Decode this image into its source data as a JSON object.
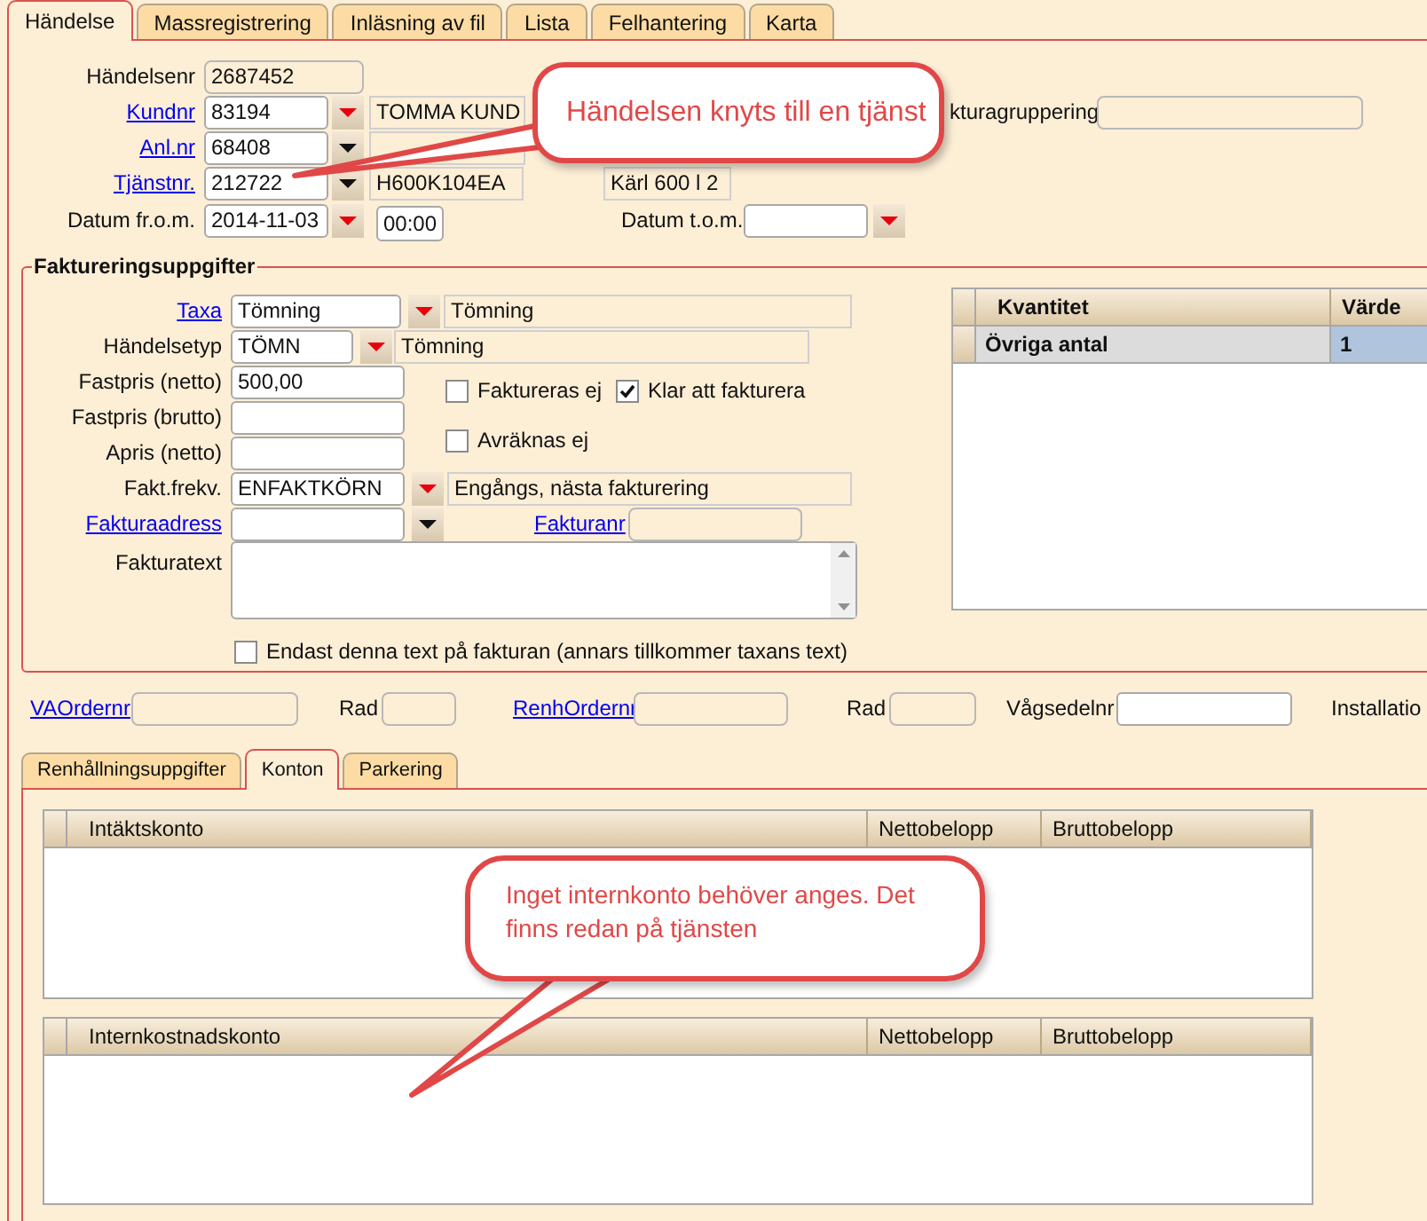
{
  "tabs": [
    {
      "label": "Händelse",
      "selected": true
    },
    {
      "label": "Massregistrering",
      "selected": false
    },
    {
      "label": "Inläsning av fil",
      "selected": false
    },
    {
      "label": "Lista",
      "selected": false
    },
    {
      "label": "Felhantering",
      "selected": false
    },
    {
      "label": "Karta",
      "selected": false
    }
  ],
  "event_fields": {
    "event_number": {
      "label": "Händelsenr",
      "link": false,
      "value": "2687452"
    },
    "customer": {
      "label": "Kundnr",
      "link": true,
      "value": "83194",
      "required": true,
      "name": "TOMMA KUND"
    },
    "invoice_grouping": {
      "label": "kturagruppering",
      "link": false
    },
    "facility": {
      "label": "Anl.nr",
      "link": true,
      "value": "68408",
      "required": false
    },
    "service": {
      "label": "Tjänstnr.",
      "link": true,
      "value": "212722",
      "required": false,
      "code": "H600K104EA",
      "description": "Kärl 600 l 2"
    },
    "date_from": {
      "label": "Datum fr.o.m.",
      "link": false,
      "value": "2014-11-03",
      "required": true,
      "time": "00:00"
    },
    "date_to": {
      "label": "Datum t.o.m.",
      "link": false,
      "required": true
    }
  },
  "billing": {
    "legend": "Faktureringsuppgifter",
    "tariff": {
      "label": "Taxa",
      "link": true,
      "value": "Tömning",
      "required": true,
      "description": "Tömning"
    },
    "event_type": {
      "label": "Händelsetyp",
      "link": false,
      "value": "TÖMN",
      "required": true,
      "description": "Tömning"
    },
    "price_fields": [
      {
        "label": "Fastpris (netto)",
        "link": false,
        "value": "500,00"
      },
      {
        "label": "Fastpris (brutto)",
        "link": false
      },
      {
        "label": "Apris (netto)",
        "link": false
      }
    ],
    "checkboxes": [
      {
        "label": "Faktureras ej",
        "checked": false
      },
      {
        "label": "Klar att fakturera",
        "checked": true
      },
      {
        "label": "Avräknas ej",
        "checked": false
      }
    ],
    "frequency": {
      "label": "Fakt.frekv.",
      "link": false,
      "value": "ENFAKTKÖRN",
      "required": true,
      "description": "Engångs, nästa fakturering"
    },
    "invoice_address": {
      "label": "Fakturaadress",
      "link": true,
      "required": false
    },
    "invoice_number": {
      "label": "Fakturanr",
      "link": true
    },
    "invoice_text": {
      "label": "Fakturatext",
      "link": false
    },
    "only_this_text": {
      "label": "Endast denna text på fakturan (annars tillkommer taxans text)",
      "checked": false
    }
  },
  "quantities": {
    "columns": [
      "Kvantitet",
      "Värde"
    ],
    "rows": [
      {
        "cells": [
          "Övriga antal",
          "1"
        ]
      }
    ]
  },
  "order_fields": [
    {
      "label": "VAOrdernr",
      "link": true,
      "kind": "readonly"
    },
    {
      "label": "Rad",
      "link": false,
      "kind": "readonly"
    },
    {
      "label": "RenhOrdernr",
      "link": true,
      "kind": "readonly"
    },
    {
      "label": "Rad",
      "link": false,
      "kind": "readonly"
    },
    {
      "label": "Vågsedelnr",
      "link": false,
      "kind": "input"
    },
    {
      "label": "Installatio",
      "link": false
    }
  ],
  "sub_tabs": [
    {
      "label": "Renhållningsuppgifter",
      "selected": false
    },
    {
      "label": "Konton",
      "selected": true
    },
    {
      "label": "Parkering",
      "selected": false
    }
  ],
  "account_grids": [
    {
      "columns": [
        "Intäktskonto",
        "Nettobelopp",
        "Bruttobelopp"
      ]
    },
    {
      "columns": [
        "Internkostnadskonto",
        "Nettobelopp",
        "Bruttobelopp"
      ]
    }
  ],
  "callouts": [
    {
      "text": "Händelsen knyts till en tjänst"
    },
    {
      "text": "Inget internkonto behöver anges. Det finns redan på tjänsten"
    }
  ]
}
